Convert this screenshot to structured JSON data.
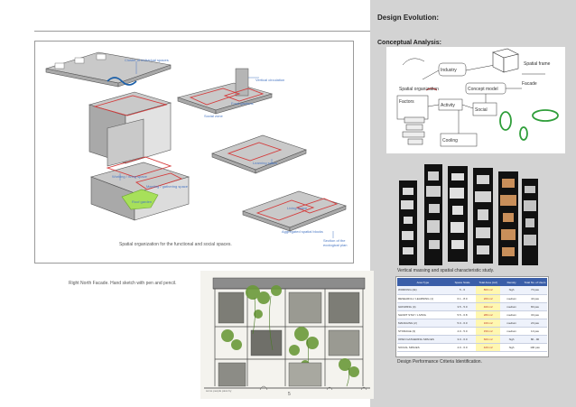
{
  "page": {
    "section_title": "Design Evolution:",
    "subsection_title": "Conceptual Analysis:",
    "page_number": "5"
  },
  "spatial_diagram": {
    "caption": "Spatial organization for the functional and social spaces.",
    "labels": {
      "cluster": "Cluster of individual spaces",
      "vertical": "Vertical circulation",
      "food_gardens": "Food gardens",
      "social_zone": "Social zone",
      "learning_space": "Learning space",
      "working_space_1": "Working / living space",
      "green": "Roof garden",
      "collab": "Meeting / gathering space",
      "living": "Living space",
      "aggregate": "Aggregated spatial blocks",
      "section": "Section of the ecological plan"
    }
  },
  "facade": {
    "caption": "Right North Facade. Hand sketch with pen and pencil.",
    "annotation": "some people pass by"
  },
  "concept_sketch": {
    "nodes": [
      "Industry",
      "Spatial organization",
      "Factors",
      "Spatial frame",
      "Concept model",
      "Facade",
      "Activity",
      "Social",
      "Cooling"
    ]
  },
  "massing_study": {
    "caption": "Vertical massing and spatial characteristic study."
  },
  "performance_table": {
    "caption": "Design Performance Criteria Identification.",
    "headers": [
      "Area Type",
      "Space Scale",
      "Total Area (m2)",
      "Density",
      "Total No. of Users"
    ],
    "rows": [
      [
        "WORKING   (2k)",
        "5 - 6",
        "800 m2",
        "high",
        "70 pax"
      ],
      [
        "RESEARCH / LEARNING (1)",
        "6.1 - 8.0",
        "200 m2",
        "medium",
        "40 pax"
      ],
      [
        "GROWING   (4)",
        "3.5 - 5.0",
        "400 m2",
        "medium",
        "80 pax"
      ],
      [
        "SHORT STAY / LIVING",
        "5.5 - 6.8",
        "280 m2",
        "medium",
        "30 pax"
      ],
      [
        "MANAGING   (2)",
        "5.0 - 6.0",
        "160 m2",
        "medium",
        "20 pax"
      ],
      [
        "STORAGE   (3)",
        "4.0 - 5.0",
        "150 m2",
        "medium",
        "10 pax"
      ],
      [
        "OPEN GATHERING SPACES",
        "3.0 - 6.0",
        "600 m2",
        "high",
        "80 - 90"
      ],
      [
        "SOCIAL SPACES",
        "4.0 - 6.0",
        "420 m2",
        "high",
        "100 pax"
      ]
    ]
  }
}
